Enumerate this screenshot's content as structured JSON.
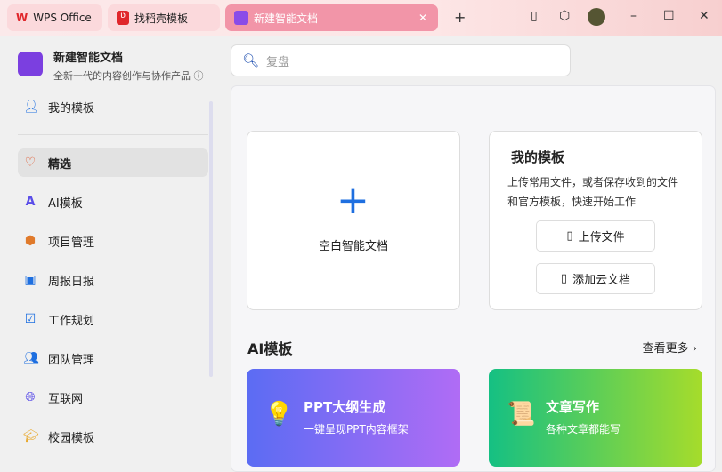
{
  "tabs": [
    {
      "label": "WPS Office"
    },
    {
      "label": "找稻壳模板"
    },
    {
      "label": "新建智能文档"
    }
  ],
  "app": {
    "title": "新建智能文档",
    "subtitle": "全新一代的内容创作与协作产品"
  },
  "sidebar": {
    "items": [
      {
        "label": "我的模板"
      },
      {
        "label": "精选"
      },
      {
        "label": "AI模板"
      },
      {
        "label": "项目管理"
      },
      {
        "label": "周报日报"
      },
      {
        "label": "工作规划"
      },
      {
        "label": "团队管理"
      },
      {
        "label": "互联网"
      },
      {
        "label": "校园模板"
      }
    ]
  },
  "search": {
    "placeholder": "复盘"
  },
  "blank": {
    "label": "空白智能文档"
  },
  "mytpl": {
    "title": "我的模板",
    "desc": "上传常用文件，或者保存收到的文件和官方模板，快速开始工作",
    "upload": "上传文件",
    "add_cloud": "添加云文档"
  },
  "ai_section": {
    "title": "AI模板",
    "more": "查看更多"
  },
  "ai_cards": [
    {
      "title": "PPT大纲生成",
      "sub": "一键呈现PPT内容框架"
    },
    {
      "title": "文章写作",
      "sub": "各种文章都能写"
    }
  ]
}
